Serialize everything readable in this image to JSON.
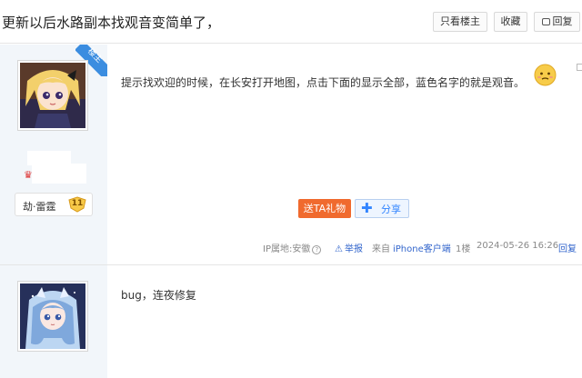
{
  "header": {
    "title": "更新以后水路副本找观音变简单了，",
    "only_op_label": "只看楼主",
    "favorite_label": "收藏",
    "reply_label": "回复"
  },
  "post1": {
    "op_badge": "楼主",
    "user_name": "劫·雷霆",
    "user_level": "11",
    "content": "提示找欢迎的时候，在长安打开地图，点击下面的显示全部，蓝色名字的就是观音。",
    "gift_label": "送TA礼物",
    "share_label": "分享",
    "ip_label": "IP属地:安徽",
    "report_label": "举报",
    "from_label": "来自",
    "client_label": "iPhone客户端",
    "floor": "1楼",
    "time": "2024-05-26 16:26",
    "reply_label": "回复"
  },
  "post2": {
    "content": "bug，连夜修复"
  },
  "colors": {
    "side_bg": "#f2f6fa",
    "gift": "#f06a2e",
    "link": "#3366cc",
    "op_ribbon": "#3b8de0"
  }
}
